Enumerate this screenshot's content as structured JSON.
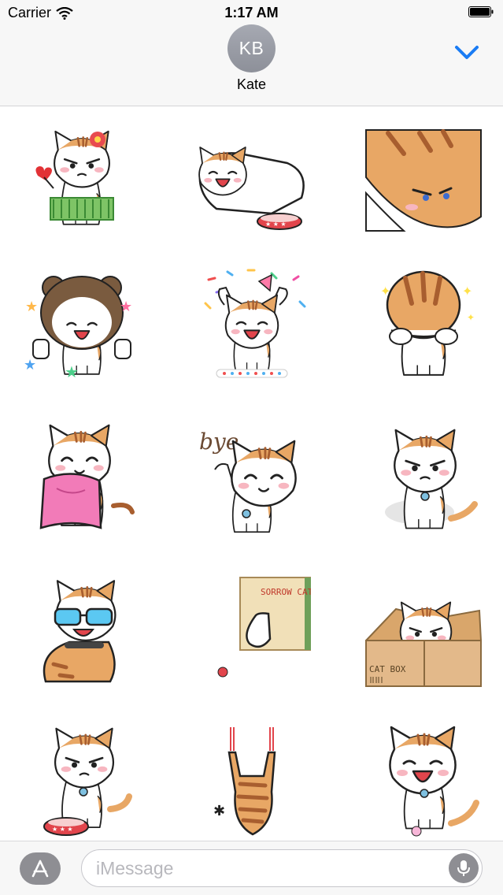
{
  "status_bar": {
    "carrier": "Carrier",
    "time": "1:17 AM",
    "wifi_icon": "wifi-icon",
    "battery_icon": "battery-icon"
  },
  "header": {
    "avatar_initials": "KB",
    "contact_name": "Kate",
    "collapse_icon": "chevron-down-icon"
  },
  "sticker_grid": {
    "stickers": [
      {
        "name": "sticker-hula-cat"
      },
      {
        "name": "sticker-hungry-cat-bowl"
      },
      {
        "name": "sticker-peeking-cat"
      },
      {
        "name": "sticker-bear-hat-cat"
      },
      {
        "name": "sticker-party-cat"
      },
      {
        "name": "sticker-shy-cat"
      },
      {
        "name": "sticker-pillow-cat"
      },
      {
        "name": "sticker-bye-cat"
      },
      {
        "name": "sticker-grumpy-cat"
      },
      {
        "name": "sticker-sunglasses-cat"
      },
      {
        "name": "sticker-box-paw-cat"
      },
      {
        "name": "sticker-cat-box"
      },
      {
        "name": "sticker-cat-bowl"
      },
      {
        "name": "sticker-hanging-cat"
      },
      {
        "name": "sticker-yawning-cat"
      }
    ],
    "texts": {
      "bye": "bye",
      "sorrow_box": "SORROW CAT",
      "cat_box": "CAT BOX"
    }
  },
  "input_bar": {
    "appstore_icon": "app-store-icon",
    "message_placeholder": "iMessage",
    "message_value": "",
    "mic_icon": "microphone-icon"
  },
  "colors": {
    "accent_blue": "#1a7cf4",
    "cat_orange": "#e8a765",
    "cat_stripe": "#a85e2f",
    "avatar_gray": "#9b9ea7",
    "header_bg": "#f7f7f7"
  }
}
